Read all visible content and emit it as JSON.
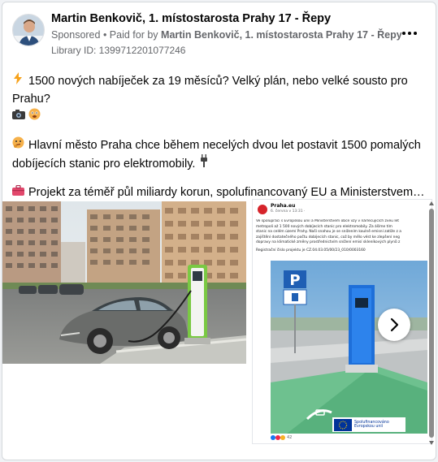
{
  "header": {
    "page_name": "Martin Benkovič, 1. místostarosta Prahy 17 - Řepy",
    "sponsored_label": "Sponsored",
    "separator": " • ",
    "paid_for_prefix": "Paid for by ",
    "paid_for_name": "Martin Benkovič, 1. místostarosta Prahy 17 - Řepy",
    "library_id": "Library ID: 1399712201077246",
    "avatar_icon": "person-avatar-icon",
    "menu_icon": "more-options-icon"
  },
  "body": {
    "paragraphs": [
      {
        "icon": "lightning-icon",
        "text": "1500 nových nabíječek za 19 měsíců? Velký plán, nebo velké sousto pro Prahu?",
        "trailing_icons": [
          "camera-icon",
          "worried-face-icon"
        ]
      },
      {
        "icon": "thinking-face-icon",
        "text": "Hlavní město Praha chce během necelých dvou let postavit 1500 pomalých dobíjecích stanic pro elektromobily.",
        "trailing_icons": [
          "plug-icon"
        ]
      },
      {
        "icon": "briefcase-icon",
        "text": "Projekt za téměř půl miliardy korun, spolufinancovaný EU a Ministerstvem…",
        "trailing_icons": []
      }
    ]
  },
  "media": {
    "image1_icon": "car-charging-photo",
    "image2": {
      "source_name": "Praha.eu",
      "source_date": "6. června v 13:31 · ",
      "text_lines": [
        "Ve spolupráci s Evropskou unií a Ministerstvem obce vzy v nárlecujících zveu let",
        "metropoli až 1 500 nových dobíjecích stanic pro elektromobily.  Za ášíme tím",
        "stanic na celém území Prahy. Naší snahou je se snížením koulně emisní zatíže z a",
        "zajištění dostatečného počtu dobíjecích stanic, což by mělo vést ke zlepšení neg",
        "dopravy na klimatické změny prostřednictvím snížení emisí skleníkových plynů z"
      ],
      "registration": "Registrační číslo projektu je  CZ.04.03.05/00/23_010/0003160",
      "eu_line1": "Spolufinancováno",
      "eu_line2": "Evropskou unií",
      "reaction_count": "42"
    },
    "next_icon": "chevron-right-icon"
  },
  "colors": {
    "text_primary": "#050505",
    "text_secondary": "#65676b",
    "card_border": "#d5d8dc",
    "charger_green": "#7ac943",
    "charger_blue": "#1e6fd9",
    "parking_sign_blue": "#1f5fb4",
    "eu_blue": "#003399",
    "eu_yellow": "#ffcc00"
  }
}
